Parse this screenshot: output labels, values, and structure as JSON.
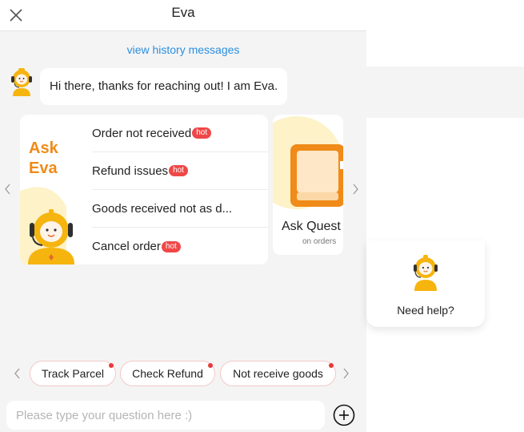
{
  "header": {
    "title": "Eva",
    "close_icon": "close-icon"
  },
  "history_link": "view history messages",
  "greeting": "Hi there, thanks for reaching out! I am Eva.",
  "ask_card": {
    "title_line1": "Ask",
    "title_line2": "Eva",
    "items": [
      {
        "label": "Order not received",
        "hot": true,
        "badge": "hot"
      },
      {
        "label": "Refund issues",
        "hot": true,
        "badge": "hot"
      },
      {
        "label": "Goods received not as d...",
        "hot": false,
        "badge": ""
      },
      {
        "label": "Cancel order",
        "hot": true,
        "badge": "hot"
      }
    ]
  },
  "side_card": {
    "title": "Ask Quest",
    "subtitle": "on orders",
    "icon": "book-icon"
  },
  "chips": [
    {
      "label": "Track Parcel",
      "dot": true
    },
    {
      "label": "Check Refund",
      "dot": true
    },
    {
      "label": "Not receive goods",
      "dot": true
    }
  ],
  "input": {
    "placeholder": "Please type your question here :)",
    "value": ""
  },
  "help_widget": {
    "label": "Need help?"
  },
  "colors": {
    "accent_orange": "#f08a18",
    "link_blue": "#2c8fde",
    "hot_red": "#ef4848",
    "panel_bg": "#f4f4f5",
    "robot_yellow": "#f6b40e"
  }
}
